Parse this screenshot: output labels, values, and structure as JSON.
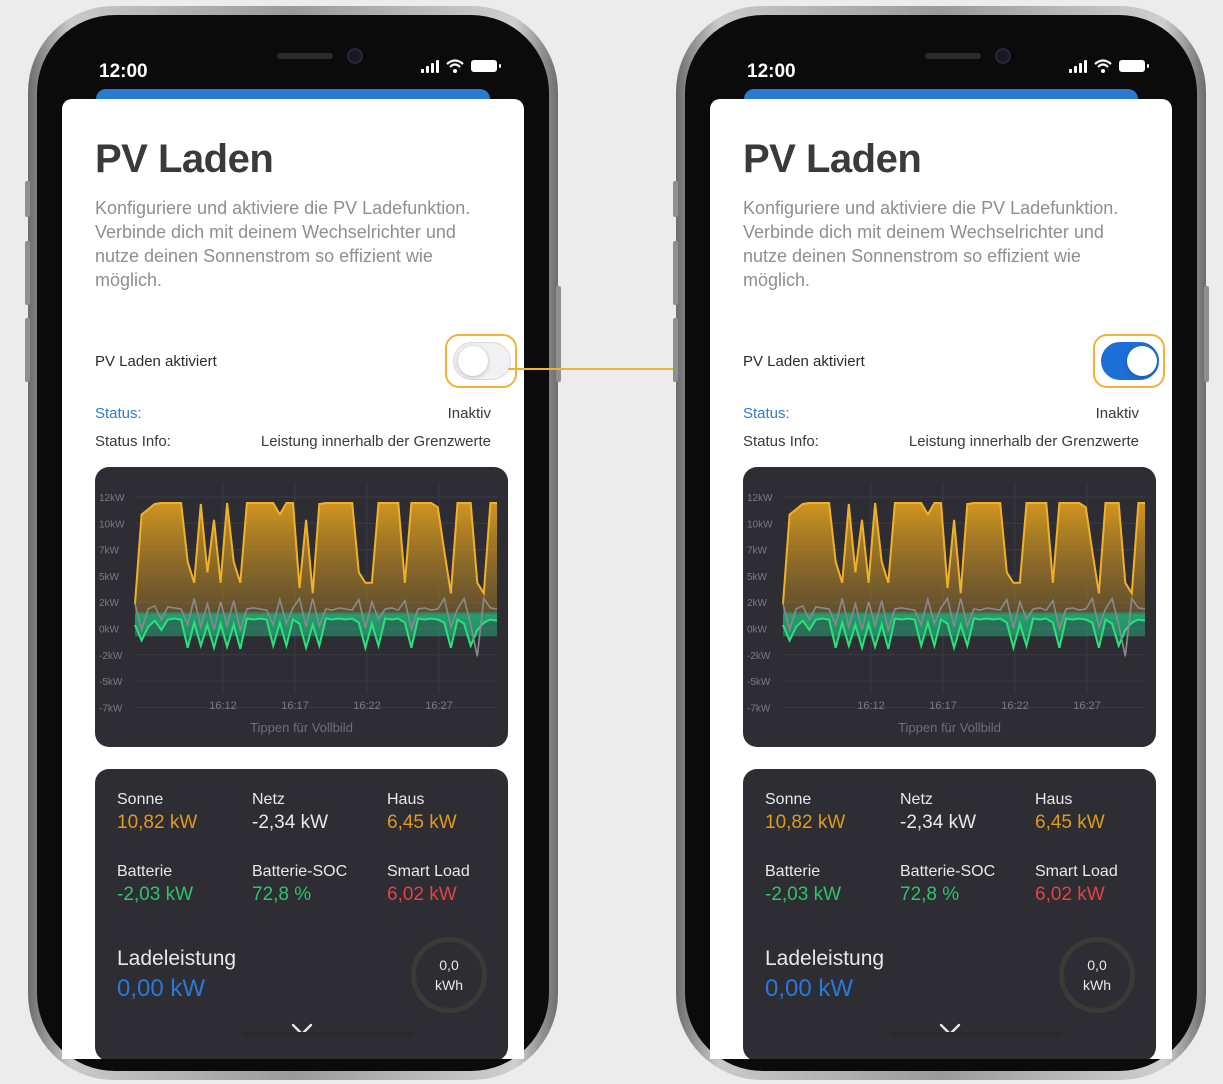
{
  "status_bar": {
    "time": "12:00"
  },
  "page": {
    "title": "PV Laden",
    "description": "Konfiguriere und aktiviere die PV Ladefunktion. Verbinde dich mit deinem Wechselrichter und nutze deinen Sonnenstrom so effizient wie möglich.",
    "toggle_label": "PV Laden aktiviert",
    "status_label": "Status:",
    "status_value": "Inaktiv",
    "status_info_label": "Status Info:",
    "status_info_value": "Leistung innerhalb der Grenzwerte"
  },
  "phones": [
    {
      "toggle_on": false
    },
    {
      "toggle_on": true
    }
  ],
  "chart_hint": "Tippen für Vollbild",
  "colors": {
    "accent": "#2b7ad1",
    "highlight": "#f0b33a",
    "sun": "#e09a1c",
    "battery": "#2ec46a",
    "house": "#8a8a8e",
    "card": "#2d2d33"
  },
  "stats": {
    "sonne": {
      "label": "Sonne",
      "value": "10,82  kW"
    },
    "netz": {
      "label": "Netz",
      "value": "-2,34  kW"
    },
    "haus": {
      "label": "Haus",
      "value": "6,45  kW"
    },
    "batterie": {
      "label": "Batterie",
      "value": "-2,03  kW"
    },
    "soc": {
      "label": "Batterie-SOC",
      "value": "72,8  %"
    },
    "smart_load": {
      "label": "Smart Load",
      "value": "6,02  kW"
    },
    "ladeleistung_label": "Ladeleistung",
    "ladeleistung_value": "0,00  kW",
    "energy_value": "0,0",
    "energy_unit": "kWh"
  },
  "chart_data": {
    "type": "area",
    "y_tick_labels": [
      "12kW",
      "10kW",
      "7kW",
      "5kW",
      "2kW",
      "0kW",
      "-2kW",
      "-5kW",
      "-7kW"
    ],
    "x_tick_labels": [
      "16:12",
      "16:17",
      "16:22",
      "16:27"
    ],
    "ylim": [
      -7.5,
      12.5
    ],
    "series": [
      {
        "values": [
          1,
          9.5,
          10,
          10.5,
          10.6,
          10.6,
          10.6,
          10.6,
          5,
          3,
          10.5,
          4,
          9,
          3,
          10.6,
          5,
          3,
          10.6,
          10.6,
          10.6,
          10.6,
          10.6,
          9.5,
          10.6,
          10.6,
          2.5,
          9,
          2,
          10.5,
          10.6,
          10.6,
          10.6,
          10.6,
          10.6,
          4,
          3,
          3,
          10.6,
          10.6,
          10.6,
          10.6,
          3,
          10.6,
          10.6,
          10.6,
          10.6,
          10.2,
          6,
          2,
          10.6,
          10.6,
          10.6,
          3,
          2,
          10.6,
          10.6
        ]
      },
      {
        "values": [
          1,
          -1.5,
          0.5,
          0.8,
          -0.5,
          0.7,
          0.6,
          0.5,
          -1,
          1.5,
          -1.2,
          1,
          -1.5,
          1.2,
          -1.1,
          1.3,
          -1.5,
          0.5,
          0.6,
          0.5,
          0.4,
          -1,
          1.4,
          -0.9,
          0.6,
          1.5,
          -1.2,
          1.5,
          -1.1,
          0.5,
          0.4,
          0.6,
          0.5,
          0.4,
          1.4,
          -1.3,
          1.2,
          -0.5,
          0.5,
          0.6,
          0.4,
          1.3,
          -1.4,
          0.5,
          0.6,
          0.4,
          0.5,
          1.5,
          -1.2,
          0.5,
          1.5,
          -1,
          -4,
          1.5,
          0.6,
          0.5
        ]
      },
      {
        "values": [
          -1,
          -2.5,
          -1.2,
          -0.6,
          -1.5,
          -0.5,
          -0.4,
          -0.5,
          -3.2,
          -0.8,
          -3,
          -1,
          -3.2,
          -0.9,
          -3.1,
          -1,
          -3.3,
          -0.4,
          -0.5,
          -0.4,
          -0.5,
          -3,
          -0.8,
          -3,
          -0.5,
          -0.9,
          -3.2,
          -1,
          -3,
          -0.4,
          -0.5,
          -0.4,
          -0.5,
          -0.4,
          -0.8,
          -3.2,
          -0.9,
          -3,
          -0.4,
          -0.5,
          -0.4,
          -0.8,
          -3.2,
          -0.4,
          -0.5,
          -0.4,
          -0.5,
          -0.8,
          -3.2,
          -0.5,
          -0.9,
          -3,
          -1.5,
          -0.8,
          -0.5,
          -0.6
        ]
      }
    ]
  }
}
